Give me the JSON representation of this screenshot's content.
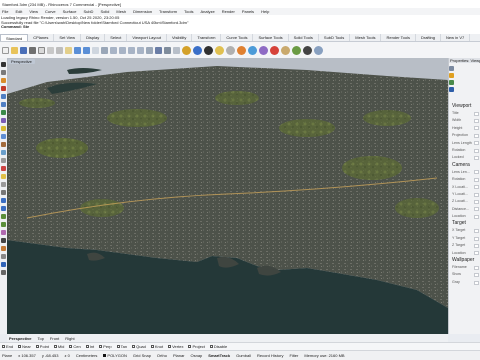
{
  "titlebar": {
    "title": "Stamford.3dm (234 MB) - Rhinoceros 7 Commercial - [Perspective]"
  },
  "menu": [
    "File",
    "Edit",
    "View",
    "Curve",
    "Surface",
    "SubD",
    "Solid",
    "Mesh",
    "Dimension",
    "Transform",
    "Tools",
    "Analyze",
    "Render",
    "Panels",
    "Help"
  ],
  "command_history": [
    "Loading legacy Rhino Render, version 1.50, Oct 25 2020, 23:20:05",
    "Successfully read file \"C:\\Users\\wah\\Desktop\\New folder\\Stamford Connecticut USA 40km\\Stamford.3dm\"",
    "Command: Ste"
  ],
  "tabs": [
    "Standard",
    "CPlanes",
    "Set View",
    "Display",
    "Select",
    "Viewport Layout",
    "Visibility",
    "Transform",
    "Curve Tools",
    "Surface Tools",
    "Solid Tools",
    "SubD Tools",
    "Mesh Tools",
    "Render Tools",
    "Drafting",
    "New in V7"
  ],
  "active_tab": "Standard",
  "viewport": {
    "label": "Perspective"
  },
  "properties": {
    "header": "Properties: Viewport",
    "sections": [
      {
        "title": "Viewport",
        "rows": [
          "Title",
          "Width",
          "Height",
          "Projection",
          "Lens Length",
          "Rotation",
          "Locked"
        ]
      },
      {
        "title": "Camera",
        "rows": [
          "Lens Len...",
          "Rotation",
          "X Locati...",
          "Y Locati...",
          "Z Locati...",
          "Distance...",
          "Location"
        ]
      },
      {
        "title": "Target",
        "rows": [
          "X Target",
          "Y Target",
          "Z Target",
          "Location"
        ]
      },
      {
        "title": "Wallpaper",
        "rows": [
          "Filename",
          "Show",
          "Gray"
        ]
      }
    ]
  },
  "view_tabs": [
    "Perspective",
    "Top",
    "Front",
    "Right"
  ],
  "osnaps": [
    "End",
    "Near",
    "Point",
    "Mid",
    "Cen",
    "Int",
    "Perp",
    "Tan",
    "Quad",
    "Knot",
    "Vertex",
    "Project",
    "Disable"
  ],
  "status": {
    "plane": "Plane",
    "x": "x 106.357",
    "y": "y -68.453",
    "z": "z 0",
    "units": "Centimeters",
    "layer": "POLYGON",
    "grid_snap": "Grid Snap",
    "ortho": "Ortho",
    "planar": "Planar",
    "osnap": "Osnap",
    "smarttrack": "SmartTrack",
    "gumball": "Gumball",
    "record_history": "Record History",
    "filter": "Filter",
    "memory": "Memory use: 2160 MB"
  },
  "colors": {
    "accent": "#2f5fb0",
    "ocean": "#253a3a",
    "land": "#4c5148",
    "vegetation": "#6c7c3a"
  }
}
